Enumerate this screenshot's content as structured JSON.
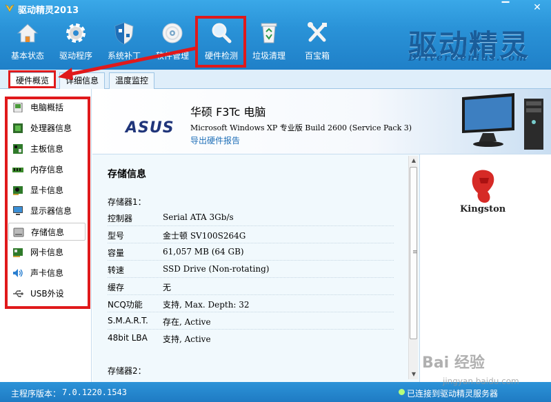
{
  "window": {
    "title": "驱动精灵2013",
    "min_glyph": "▔",
    "close_glyph": "✕"
  },
  "toolbar": [
    {
      "label": "基本状态",
      "icon": "home-icon"
    },
    {
      "label": "驱动程序",
      "icon": "gear-icon"
    },
    {
      "label": "系统补丁",
      "icon": "shield-icon"
    },
    {
      "label": "软件管理",
      "icon": "disc-icon"
    },
    {
      "label": "硬件检测",
      "icon": "magnifier-icon"
    },
    {
      "label": "垃圾清理",
      "icon": "recycle-bin-icon"
    },
    {
      "label": "百宝箱",
      "icon": "tools-icon"
    }
  ],
  "brand": {
    "cn": "驱动精灵",
    "en": "DriverGenius.com"
  },
  "tabs": [
    {
      "label": "硬件概览"
    },
    {
      "label": "详细信息"
    },
    {
      "label": "温度监控"
    }
  ],
  "sidebar": [
    {
      "label": "电脑概括",
      "icon": "computer-summary-icon"
    },
    {
      "label": "处理器信息",
      "icon": "cpu-icon"
    },
    {
      "label": "主板信息",
      "icon": "motherboard-icon"
    },
    {
      "label": "内存信息",
      "icon": "memory-icon"
    },
    {
      "label": "显卡信息",
      "icon": "graphics-card-icon"
    },
    {
      "label": "显示器信息",
      "icon": "monitor-icon"
    },
    {
      "label": "存储信息",
      "icon": "storage-icon"
    },
    {
      "label": "网卡信息",
      "icon": "network-card-icon"
    },
    {
      "label": "声卡信息",
      "icon": "speaker-icon"
    },
    {
      "label": "USB外设",
      "icon": "usb-icon"
    }
  ],
  "device": {
    "vendor_logo": "ASUS",
    "name": "华硕 F3Tc 电脑",
    "os": "Microsoft Windows XP 专业版 Build 2600 (Service Pack 3)",
    "export_link": "导出硬件报告"
  },
  "storage": {
    "title": "存储信息",
    "disk1_label": "存储器1：",
    "disk2_label": "存储器2：",
    "rows": [
      {
        "key": "控制器",
        "value": "Serial ATA 3Gb/s"
      },
      {
        "key": "型号",
        "value": "金士顿 SV100S264G"
      },
      {
        "key": "容量",
        "value": "61,057 MB (64 GB)"
      },
      {
        "key": "转速",
        "value": "SSD Drive (Non-rotating)"
      },
      {
        "key": "缓存",
        "value": "无"
      },
      {
        "key": "NCQ功能",
        "value": "支持, Max. Depth: 32"
      },
      {
        "key": "S.M.A.R.T.",
        "value": "存在, Active"
      },
      {
        "key": "48bit LBA",
        "value": "支持, Active"
      }
    ]
  },
  "right_logo": "Kingston",
  "status": {
    "version_label": "主程序版本：",
    "version": "7.0.1220.1543",
    "connection": "已连接到驱动精灵服务器"
  },
  "watermark": {
    "main": "Bai 经验",
    "sub": "jingyan.baidu.com"
  }
}
